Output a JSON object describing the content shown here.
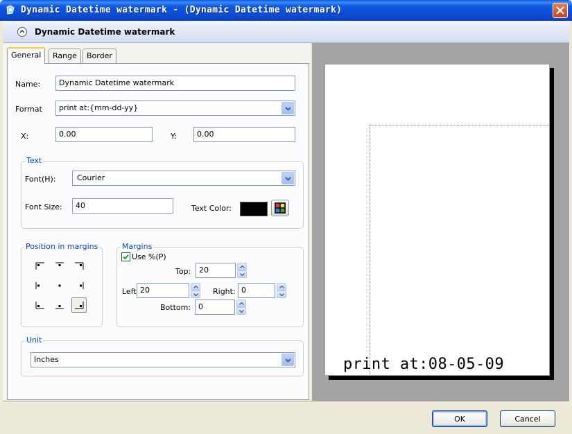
{
  "window": {
    "title": "Dynamic Datetime watermark - (Dynamic Datetime watermark)",
    "header_title": "Dynamic Datetime watermark"
  },
  "tabs": [
    {
      "label": "General",
      "hotkey": "G"
    },
    {
      "label": "Range",
      "hotkey": "a"
    },
    {
      "label": "Border",
      "hotkey": "B"
    }
  ],
  "general": {
    "name_label": "Name:",
    "name_value": "Dynamic Datetime watermark",
    "format_label": "Format",
    "format_value": "print at:{mm-dd-yy}",
    "x_label": "X:",
    "x_value": "0.00",
    "y_label": "Y:",
    "y_value": "0.00"
  },
  "text_group": {
    "legend": "Text",
    "font_label": "Font(H):",
    "font_value": "Courier",
    "font_size_label": "Font Size:",
    "font_size_value": "40",
    "text_color_label": "Text Color:",
    "text_color": "#000000"
  },
  "position_group": {
    "legend": "Position in margins",
    "selected": "bottom-right"
  },
  "margins_group": {
    "legend": "Margins",
    "use_percent_label": "Use %(P)",
    "use_percent_checked": true,
    "top_label": "Top:",
    "top_value": "20",
    "left_label": "Left:",
    "left_value": "20",
    "right_label": "Right:",
    "right_value": "0",
    "bottom_label": "Bottom:",
    "bottom_value": "0"
  },
  "unit_group": {
    "legend": "Unit",
    "unit_value": "Inches"
  },
  "preview": {
    "watermark_text": "print at:08-05-09"
  },
  "buttons": {
    "ok_label": "OK",
    "cancel_label": "Cancel"
  }
}
